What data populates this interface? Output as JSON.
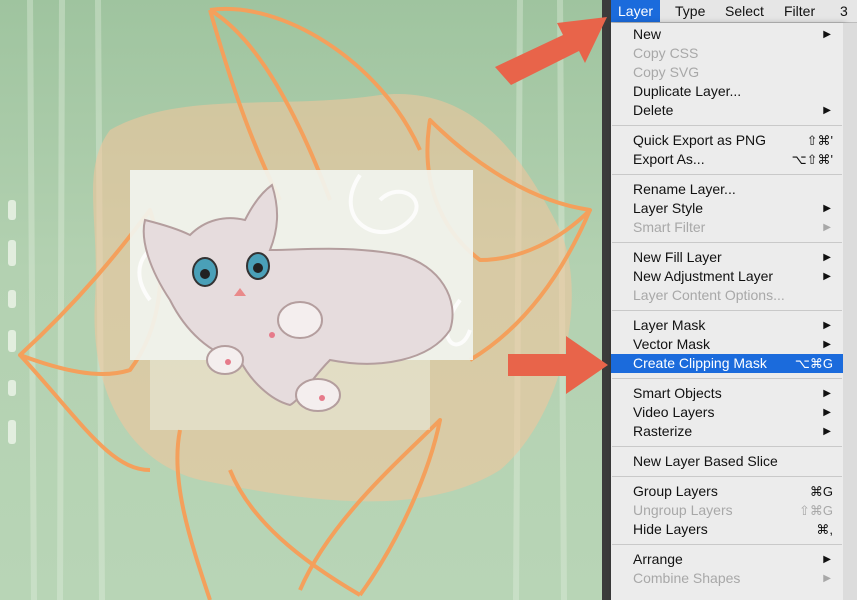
{
  "menubar": {
    "items": [
      "Layer",
      "Type",
      "Select",
      "Filter",
      "3"
    ],
    "active_index": 0
  },
  "menu": {
    "groups": [
      [
        {
          "label": "New",
          "shortcut": "",
          "submenu": true,
          "disabled": false
        },
        {
          "label": "Copy CSS",
          "shortcut": "",
          "submenu": false,
          "disabled": true
        },
        {
          "label": "Copy SVG",
          "shortcut": "",
          "submenu": false,
          "disabled": true
        },
        {
          "label": "Duplicate Layer...",
          "shortcut": "",
          "submenu": false,
          "disabled": false
        },
        {
          "label": "Delete",
          "shortcut": "",
          "submenu": true,
          "disabled": false
        }
      ],
      [
        {
          "label": "Quick Export as PNG",
          "shortcut": "⇧⌘'",
          "submenu": false,
          "disabled": false
        },
        {
          "label": "Export As...",
          "shortcut": "⌥⇧⌘'",
          "submenu": false,
          "disabled": false
        }
      ],
      [
        {
          "label": "Rename Layer...",
          "shortcut": "",
          "submenu": false,
          "disabled": false
        },
        {
          "label": "Layer Style",
          "shortcut": "",
          "submenu": true,
          "disabled": false
        },
        {
          "label": "Smart Filter",
          "shortcut": "",
          "submenu": true,
          "disabled": true
        }
      ],
      [
        {
          "label": "New Fill Layer",
          "shortcut": "",
          "submenu": true,
          "disabled": false
        },
        {
          "label": "New Adjustment Layer",
          "shortcut": "",
          "submenu": true,
          "disabled": false
        },
        {
          "label": "Layer Content Options...",
          "shortcut": "",
          "submenu": false,
          "disabled": true
        }
      ],
      [
        {
          "label": "Layer Mask",
          "shortcut": "",
          "submenu": true,
          "disabled": false
        },
        {
          "label": "Vector Mask",
          "shortcut": "",
          "submenu": true,
          "disabled": false
        },
        {
          "label": "Create Clipping Mask",
          "shortcut": "⌥⌘G",
          "submenu": false,
          "disabled": false,
          "highlighted": true
        }
      ],
      [
        {
          "label": "Smart Objects",
          "shortcut": "",
          "submenu": true,
          "disabled": false
        },
        {
          "label": "Video Layers",
          "shortcut": "",
          "submenu": true,
          "disabled": false
        },
        {
          "label": "Rasterize",
          "shortcut": "",
          "submenu": true,
          "disabled": false
        }
      ],
      [
        {
          "label": "New Layer Based Slice",
          "shortcut": "",
          "submenu": false,
          "disabled": false
        }
      ],
      [
        {
          "label": "Group Layers",
          "shortcut": "⌘G",
          "submenu": false,
          "disabled": false
        },
        {
          "label": "Ungroup Layers",
          "shortcut": "⇧⌘G",
          "submenu": false,
          "disabled": true
        },
        {
          "label": "Hide Layers",
          "shortcut": "⌘,",
          "submenu": false,
          "disabled": false
        }
      ],
      [
        {
          "label": "Arrange",
          "shortcut": "",
          "submenu": true,
          "disabled": false
        },
        {
          "label": "Combine Shapes",
          "shortcut": "",
          "submenu": true,
          "disabled": true
        }
      ]
    ]
  },
  "colors": {
    "accent": "#1b6bdc",
    "callout_arrow": "#e8644a",
    "flower_outline": "#f4a05c",
    "canvas_green": "#b3d1b1"
  },
  "icons": [
    "arrow-callout-icon",
    "submenu-arrow-icon",
    "kitten-artwork"
  ]
}
